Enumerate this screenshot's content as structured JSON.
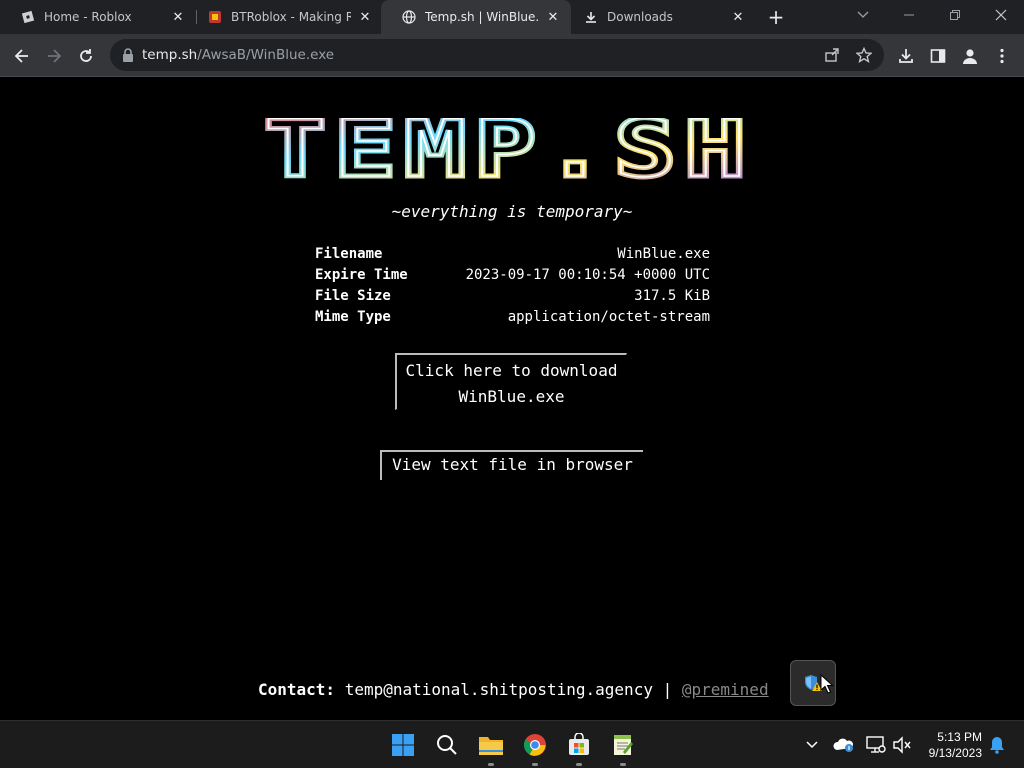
{
  "browser": {
    "tabs": [
      {
        "title": "Home - Roblox",
        "icon": "roblox-icon",
        "active": false
      },
      {
        "title": "BTRoblox - Making Rob",
        "icon": "btroblox-icon",
        "active": false
      },
      {
        "title": "Temp.sh | WinBlue.exe",
        "icon": "globe-icon",
        "active": true
      },
      {
        "title": "Downloads",
        "icon": "download-icon",
        "active": false
      }
    ],
    "address": {
      "host": "temp.sh",
      "path": "/AwsaB/WinBlue.exe"
    }
  },
  "page": {
    "logo_text": "TEMP.SH",
    "tagline": "~everything is temporary~",
    "info": [
      {
        "key": "Filename",
        "value": "WinBlue.exe"
      },
      {
        "key": "Expire Time",
        "value": "2023-09-17 00:10:54 +0000 UTC"
      },
      {
        "key": "File Size",
        "value": "317.5 KiB"
      },
      {
        "key": "Mime Type",
        "value": "application/octet-stream"
      }
    ],
    "download_button": {
      "line1": "Click here to download",
      "line2": "WinBlue.exe"
    },
    "view_button": "View text file in browser",
    "footer": {
      "label": "Contact:",
      "email": "temp@national.shitposting.agency",
      "separator": "|",
      "handle": "@premined"
    }
  },
  "taskbar": {
    "apps": [
      "windows-start-icon",
      "search-icon",
      "file-explorer-icon",
      "chrome-icon",
      "microsoft-store-icon",
      "notepad-plus-icon"
    ],
    "clock": {
      "time": "5:13 PM",
      "date": "9/13/2023"
    }
  },
  "colors": {
    "page_bg": "#000000",
    "chrome_bg": "#202124",
    "toolbar_bg": "#35363a",
    "taskbar_bg": "#1c1c1c",
    "link_muted": "#888888"
  }
}
